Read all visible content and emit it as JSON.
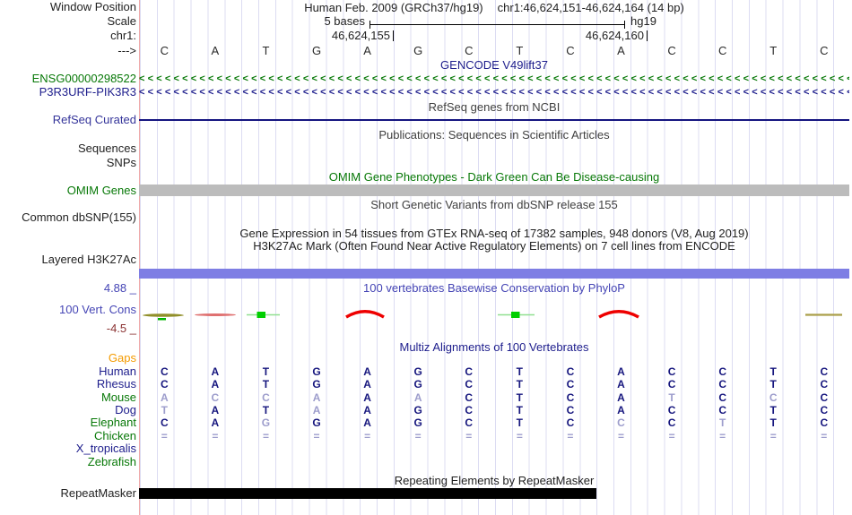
{
  "header": {
    "window_position_label": "Window Position",
    "assembly_title": "Human Feb. 2009 (GRCh37/hg19)",
    "position_range": "chr1:46,624,151-46,624,164 (14 bp)",
    "scale_label": "Scale",
    "scale_value": "5 bases",
    "assembly_tag": "hg19",
    "chrom_label": "chr1:",
    "strand_label": "--->",
    "coordinates": [
      "46,624,155",
      "46,624,160"
    ]
  },
  "sequence": {
    "bases": [
      "C",
      "A",
      "T",
      "G",
      "A",
      "G",
      "C",
      "T",
      "C",
      "A",
      "C",
      "C",
      "T",
      "C"
    ]
  },
  "tracks": {
    "gencode": {
      "title": "GENCODE V49lift37",
      "genes": [
        {
          "label": "ENSG00000298522"
        },
        {
          "label": "P3R3URF-PIK3R3"
        }
      ],
      "arrow_pattern": "<<<<<<<<<<<<<<<<<<<<<<<<<<<<<<<<<<<<<<<<<<<<<<<<<<<<<<<<<<<<<<<<<<<<<<<<<<<<<<<<<<<<<<<<<<"
    },
    "refseq": {
      "title": "RefSeq genes from NCBI",
      "label": "RefSeq Curated"
    },
    "publications": {
      "title": "Publications: Sequences in Scientific Articles"
    },
    "sequences_label": "Sequences",
    "snps_label": "SNPs",
    "omim": {
      "title": "OMIM Gene Phenotypes - Dark Green Can Be Disease-causing",
      "label": "OMIM Genes"
    },
    "dbsnp": {
      "title": "Short Genetic Variants from dbSNP release 155",
      "label": "Common dbSNP(155)"
    },
    "gtex": {
      "title": "Gene Expression in 54 tissues from GTEx RNA-seq of 17382 samples, 948 donors (V8, Aug 2019)"
    },
    "h3k27ac": {
      "title": "H3K27Ac Mark (Often Found Near Active Regulatory Elements) on 7 cell lines from ENCODE",
      "label": "Layered H3K27Ac"
    },
    "conservation": {
      "title": "100 vertebrates Basewise Conservation by PhyloP",
      "label": "100 Vert. Cons",
      "max": "4.88 _",
      "min": "-4.5 _"
    },
    "multiz": {
      "title": "Multiz Alignments of 100 Vertebrates",
      "gaps_label": "Gaps",
      "rows": [
        {
          "name": "Human",
          "cells": [
            "C",
            "A",
            "T",
            "G",
            "A",
            "G",
            "C",
            "T",
            "C",
            "A",
            "C",
            "C",
            "T",
            "C"
          ]
        },
        {
          "name": "Rhesus",
          "cells": [
            "C",
            "A",
            "T",
            "G",
            "A",
            "G",
            "C",
            "T",
            "C",
            "A",
            "C",
            "C",
            "T",
            "C"
          ]
        },
        {
          "name": "Mouse",
          "cells": [
            {
              "c": "A",
              "dim": true
            },
            {
              "c": "C",
              "dim": true
            },
            {
              "c": "C",
              "dim": true
            },
            {
              "c": "A",
              "dim": true
            },
            "A",
            {
              "c": "A",
              "dim": true
            },
            "C",
            "T",
            "C",
            "A",
            {
              "c": "T",
              "dim": true
            },
            "C",
            {
              "c": "C",
              "dim": true
            },
            "C"
          ]
        },
        {
          "name": "Dog",
          "cells": [
            {
              "c": "T",
              "dim": true
            },
            "A",
            "T",
            {
              "c": "A",
              "dim": true
            },
            "A",
            "G",
            "C",
            "T",
            "C",
            "A",
            "C",
            "C",
            "T",
            "C"
          ]
        },
        {
          "name": "Elephant",
          "cells": [
            "C",
            "A",
            {
              "c": "G",
              "dim": true
            },
            "G",
            "A",
            "G",
            "C",
            "T",
            "C",
            {
              "c": "C",
              "dim": true
            },
            "C",
            {
              "c": "T",
              "dim": true
            },
            "T",
            "C"
          ]
        },
        {
          "name": "Chicken",
          "cells": [
            {
              "c": "=",
              "dim": true
            },
            {
              "c": "=",
              "dim": true
            },
            {
              "c": "=",
              "dim": true
            },
            {
              "c": "=",
              "dim": true
            },
            {
              "c": "=",
              "dim": true
            },
            {
              "c": "=",
              "dim": true
            },
            {
              "c": "=",
              "dim": true
            },
            {
              "c": "=",
              "dim": true
            },
            {
              "c": "=",
              "dim": true
            },
            {
              "c": "=",
              "dim": true
            },
            {
              "c": "=",
              "dim": true
            },
            {
              "c": "=",
              "dim": true
            },
            {
              "c": "=",
              "dim": true
            },
            {
              "c": "=",
              "dim": true
            }
          ]
        },
        {
          "name": "X_tropicalis",
          "cells": []
        },
        {
          "name": "Zebrafish",
          "cells": []
        }
      ]
    },
    "repeatmasker": {
      "title": "Repeating Elements by RepeatMasker",
      "label": "RepeatMasker"
    }
  },
  "colors": {
    "green_label": "#077807",
    "navy_label": "#1d1d8c",
    "conservation_blue": "#4545b5",
    "min_maroon": "#8b3333",
    "gaps_orange": "#f49b00",
    "omim_bar": "#bcbcbc",
    "h3k27ac_bar": "#7e7ee4",
    "repeat_bar": "#000000",
    "marker_line": "#f0aaaa",
    "gridline": "#dcdcf2"
  }
}
